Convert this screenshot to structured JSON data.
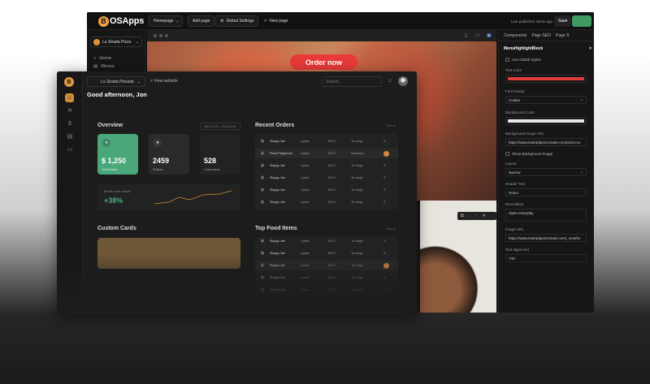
{
  "builder": {
    "logo_letter": "B",
    "logo_text": "OSApps",
    "page_select": "Homepage",
    "add_page": "Add page",
    "global_settings": "Global Settings",
    "view_page": "View page",
    "last_published": "Last published 19min ago",
    "save": "Save",
    "site_name": "La Strada Pizza",
    "nav": [
      {
        "icon": "⌂",
        "label": "Home"
      },
      {
        "icon": "▤",
        "label": "Menus"
      }
    ],
    "order_now": "Order now",
    "panel": {
      "tabs": [
        "Components",
        "Page SEO",
        "Page S"
      ],
      "block_title": "MenuHighlightBlock",
      "close": "×",
      "use_global_styles": "Use Global Styles",
      "text_color_label": "Text Color",
      "text_color": "#e03b3b",
      "font_family_label": "Font Family",
      "font_family": "Cookie",
      "bg_color_label": "Background Color",
      "bg_color": "#e8e8e8",
      "bg_image_url_label": "Background Image URL",
      "bg_image_url": "https://www.lastradapizzeriawt.com/pizza-ca",
      "show_bg_image": "Show Background Image",
      "layout_label": "Layout",
      "layout": "Narrow",
      "header_text_label": "Header Text",
      "header_text": "Hours",
      "description_label": "Description",
      "description": "Open everyday",
      "image_url_label": "Image URL",
      "image_url": "https://www.lastradapizzeriawt.com/_next/im",
      "extra_label": "Text alignment",
      "extra_value": "Title"
    }
  },
  "dash": {
    "logo_letter": "B",
    "site_select": "La Strada Pinsalia",
    "view_website": "View website",
    "search_placeholder": "Search...",
    "greeting": "Good afternoon, Jon",
    "overview": "Overview",
    "date_range": "2024-01-01 – 2024-12-31",
    "stats": [
      {
        "value": "$ 1,250",
        "label": "Total Sales",
        "bg": "#4aa77a"
      },
      {
        "value": "2459",
        "label": "Orders",
        "bg": "#2a2a2a"
      },
      {
        "value": "528",
        "label": "Customers",
        "bg": "#222222"
      }
    ],
    "growth_label": "Month-over-month",
    "growth_value": "+38%",
    "recent_orders": "Recent Orders",
    "see_all": "See all",
    "orders": [
      {
        "name": "Sloppy Joe",
        "type": "Lynaa",
        "price": "$ 8.5",
        "status": "To range",
        "dot": ""
      },
      {
        "name": "Pizza Pepperoni",
        "type": "Lynaa",
        "price": "$ 8.5",
        "status": "Incubator",
        "dot": "#d48a3c"
      },
      {
        "name": "Sloppy Joe",
        "type": "Lynaa",
        "price": "$ 8.5",
        "status": "To range",
        "dot": ""
      },
      {
        "name": "Sloppy Joe",
        "type": "Lynaa",
        "price": "$ 8.5",
        "status": "To range",
        "dot": ""
      },
      {
        "name": "Sloppy Joe",
        "type": "Lynaa",
        "price": "$ 8.5",
        "status": "To range",
        "dot": ""
      },
      {
        "name": "Sloppy Joe",
        "type": "Lynaa",
        "price": "$ 8.5",
        "status": "To range",
        "dot": ""
      }
    ],
    "custom_cards": "Custom Cards",
    "top_food": "Top Food Items",
    "food": [
      {
        "name": "Sloppy Joe",
        "type": "Lynaa",
        "price": "$ 8.5",
        "status": "To range",
        "dot": ""
      },
      {
        "name": "Sloppy Joe",
        "type": "Lynaa",
        "price": "$ 8.5",
        "status": "To range",
        "dot": ""
      },
      {
        "name": "Sloppy Joe",
        "type": "Lynaa",
        "price": "$ 8.5",
        "status": "To range",
        "dot": "#d48a3c"
      },
      {
        "name": "Sloppy Joe",
        "type": "Lynaa",
        "price": "$ 8.5",
        "status": "To range",
        "dot": ""
      },
      {
        "name": "Sloppy Joe",
        "type": "Lynaa",
        "price": "$ 8.5",
        "status": "To range",
        "dot": ""
      }
    ]
  }
}
